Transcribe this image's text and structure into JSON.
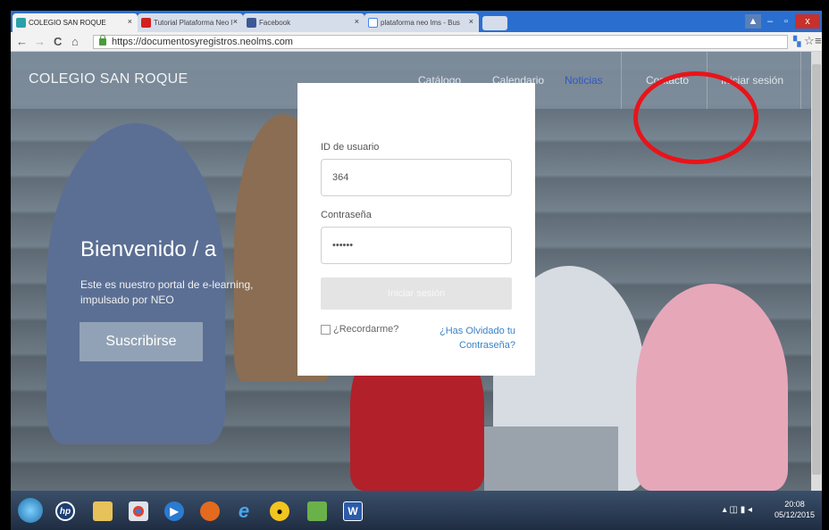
{
  "browser": {
    "tabs": [
      {
        "label": "COLEGIO SAN ROQUE",
        "active": true
      },
      {
        "label": "Tutorial Plataforma Neo l",
        "active": false
      },
      {
        "label": "Facebook",
        "active": false
      },
      {
        "label": "plataforma neo lms - Bus",
        "active": false
      }
    ],
    "url": "https://documentosyregistros.neolms.com",
    "nav": {
      "back": "←",
      "forward": "→",
      "reload": "C",
      "home": "⌂"
    },
    "window": {
      "minimize": "–",
      "restore": "▫",
      "close": "x"
    }
  },
  "site": {
    "brand": "COLEGIO SAN ROQUE",
    "nav": [
      "Catálogo",
      "Calendario",
      "Noticias",
      "Contacto",
      "Iniciar sesión"
    ],
    "welcome": "Bienvenido / a",
    "tagline": "Este es nuestro portal de e-learning, impulsado por NEO",
    "subscribe": "Suscribirse"
  },
  "login": {
    "user_label": "ID de usuario",
    "user_value": "364",
    "password_label": "Contraseña",
    "password_value": "••••••",
    "submit": "Iniciar sesión",
    "remember": "¿Recordarme?",
    "forgot": "¿Has Olvidado tu Contraseña?"
  },
  "taskbar": {
    "time": "20:08",
    "date": "05/12/2015"
  },
  "colors": {
    "highlight": "#e8141a",
    "active_nav": "#2e57c8",
    "link": "#3a82c8"
  }
}
